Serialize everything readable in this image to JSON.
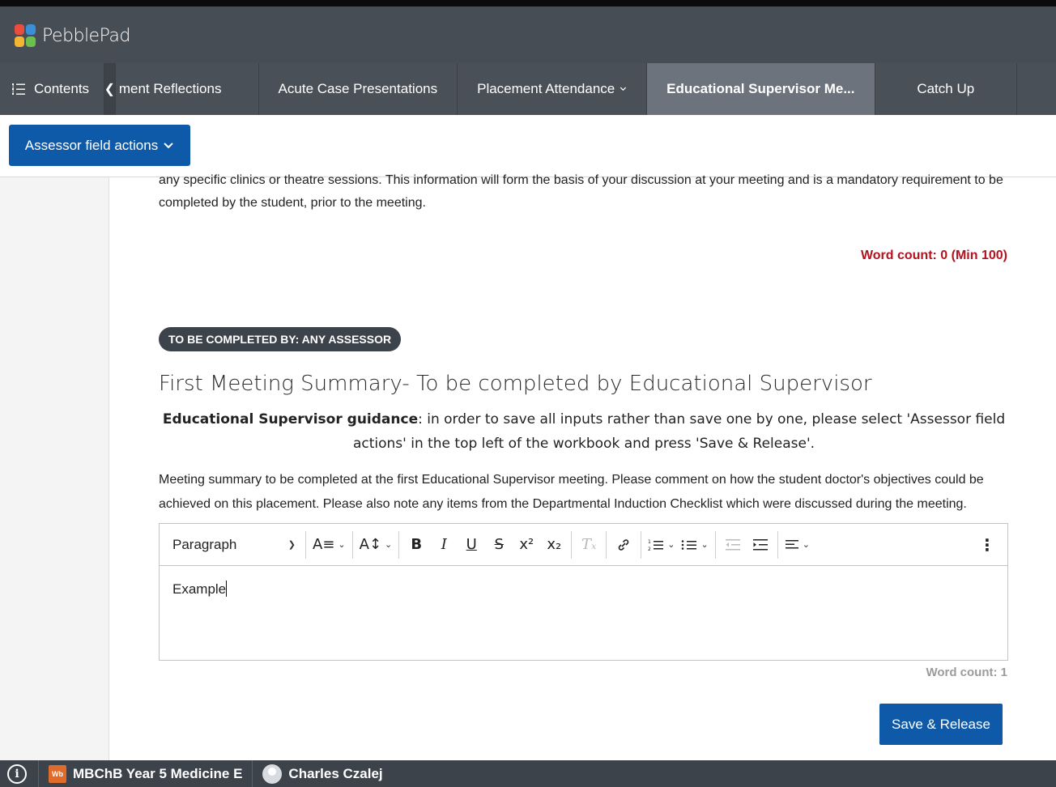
{
  "app": {
    "name": "PebblePad",
    "logo_colors": [
      "#e94e3c",
      "#3b8fd6",
      "#f2b632",
      "#6cbf4a"
    ]
  },
  "tabs": {
    "contents_label": "Contents",
    "items": [
      {
        "label": "ment Reflections"
      },
      {
        "label": "Acute Case Presentations"
      },
      {
        "label": "Placement Attendance"
      },
      {
        "label": "Educational Supervisor Me..."
      },
      {
        "label": "Catch Up"
      }
    ]
  },
  "assessor_actions": {
    "label": "Assessor field actions"
  },
  "content": {
    "intro_text": "any specific clinics or theatre sessions. This information will form the basis of your discussion at your meeting and is a mandatory requirement to be completed by the student, prior to the meeting.",
    "word_count_top": "Word count: 0 (Min 100)",
    "badge": "TO BE COMPLETED BY: ANY ASSESSOR",
    "section_title": "First Meeting Summary- To be completed by Educational Supervisor",
    "guidance_bold": "Educational Supervisor guidance",
    "guidance_text": ": in order to save all inputs rather than save one by one, please select 'Assessor field actions' in the top left of the workbook and press 'Save & Release'.",
    "meeting_desc": "Meeting summary to be completed at the first Educational Supervisor meeting. Please comment on how the student doctor's objectives could be achieved on this placement. Please also note any items from the Departmental Induction Checklist which were discussed during the meeting.",
    "editor": {
      "paragraph_select": "Paragraph",
      "body_text": "Example"
    },
    "word_count_bottom": "Word count: 1",
    "save_label": "Save & Release"
  },
  "bottom": {
    "info_label": "i",
    "wb_label": "Wb",
    "workbook": "MBChB Year 5 Medicine E",
    "user": "Charles Czalej"
  },
  "colors": {
    "accent": "#0f5aa8",
    "warning": "#b3121e",
    "topbar": "#474d55"
  }
}
